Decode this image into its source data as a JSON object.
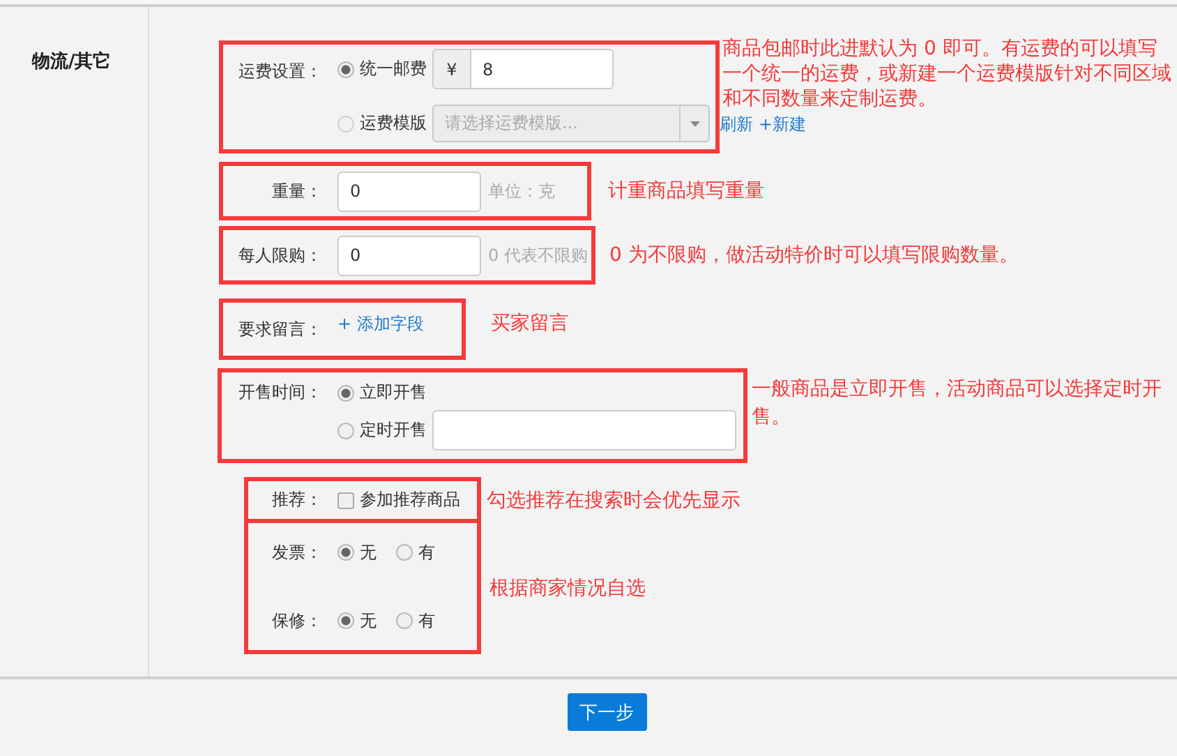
{
  "section": "物流/其它",
  "freight": {
    "label": "运费设置：",
    "flat": {
      "label": "统一邮费",
      "selected": true,
      "currency": "¥",
      "value": "8"
    },
    "template": {
      "label": "运费模版",
      "selected": false,
      "placeholder": "请选择运费模版..."
    },
    "links": [
      "刷新",
      "+新建"
    ],
    "note": "商品包邮时此进默认为 0 即可。有运费的可以填写一个统一的运费，或新建一个运费模版针对不同区域和不同数量来定制运费。"
  },
  "weight": {
    "label": "重量：",
    "value": "0",
    "hint": "单位：克",
    "note": "计重商品填写重量"
  },
  "limit": {
    "label": "每人限购：",
    "value": "0",
    "hint": "0 代表不限购",
    "note": "0 为不限购，做活动特价时可以填写限购数量。"
  },
  "message": {
    "label": "要求留言：",
    "link": "+ 添加字段",
    "note": "买家留言"
  },
  "sale_time": {
    "label": "开售时间：",
    "options": [
      {
        "label": "立即开售",
        "selected": true
      },
      {
        "label": "定时开售",
        "selected": false
      }
    ],
    "note": "一般商品是立即开售，活动商品可以选择定时开售。"
  },
  "recommend": {
    "label": "推荐：",
    "option": "参加推荐商品",
    "checked": false,
    "note": "勾选推荐在搜索时会优先显示"
  },
  "extras": {
    "rows": [
      {
        "label": "发票：",
        "options": [
          {
            "label": "无",
            "selected": true
          },
          {
            "label": "有",
            "selected": false
          }
        ]
      },
      {
        "label": "保修：",
        "options": [
          {
            "label": "无",
            "selected": true
          },
          {
            "label": "有",
            "selected": false
          }
        ]
      }
    ],
    "note": "根据商家情况自选"
  },
  "next_button": "下一步"
}
